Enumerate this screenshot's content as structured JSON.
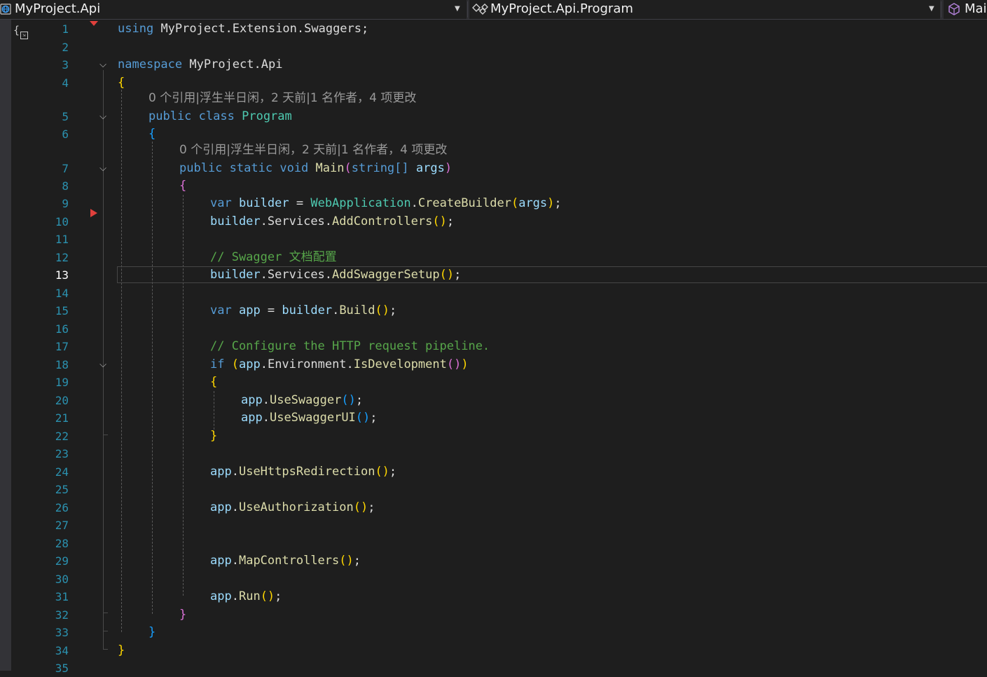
{
  "navbar": {
    "project": "MyProject.Api",
    "type_member": "MyProject.Api.Program",
    "member": "Mai"
  },
  "editor": {
    "active_line": 13,
    "line_numbers": [
      "1",
      "2",
      "3",
      "4",
      "5",
      "6",
      "7",
      "8",
      "9",
      "10",
      "11",
      "12",
      "13",
      "14",
      "15",
      "16",
      "17",
      "18",
      "19",
      "20",
      "21",
      "22",
      "23",
      "24",
      "25",
      "26",
      "27",
      "28",
      "29",
      "30",
      "31",
      "32",
      "33",
      "34",
      "35"
    ],
    "codelens": {
      "class_program": "0 个引用|浮生半日闲，2 天前|1 名作者，4 项更改",
      "method_main": "0 个引用|浮生半日闲，2 天前|1 名作者，4 项更改"
    },
    "tokens": {
      "using": "using",
      "using_ns": "MyProject.Extension.Swaggers;",
      "namespace": "namespace",
      "ns_name": "MyProject.Api",
      "public": "public",
      "class": "class",
      "class_name": "Program",
      "static": "static",
      "void": "void",
      "main": "Main",
      "string_arr": "string[]",
      "args": "args",
      "var": "var",
      "builder": "builder",
      "webapp": "WebApplication",
      "create_builder": "CreateBuilder",
      "services": "Services",
      "add_controllers": "AddControllers",
      "comment_swagger": "// Swagger 文档配置",
      "add_swagger_setup": "AddSwaggerSetup",
      "app": "app",
      "build": "Build",
      "comment_pipeline": "// Configure the HTTP request pipeline.",
      "if": "if",
      "environment": "Environment",
      "is_development": "IsDevelopment",
      "use_swagger": "UseSwagger",
      "use_swagger_ui": "UseSwaggerUI",
      "use_https": "UseHttpsRedirection",
      "use_auth": "UseAuthorization",
      "map_controllers": "MapControllers",
      "run": "Run"
    }
  },
  "colors": {
    "keyword": "#569cd6",
    "type": "#4ec9b0",
    "method": "#dcdcaa",
    "parameter": "#9cdcfe",
    "comment": "#57a64a",
    "line_number": "#2b91af",
    "bracket_1": "#ffd700",
    "bracket_2": "#da70d6",
    "bracket_3": "#179fff"
  },
  "icons": {
    "project_icon": "csharp-project-icon",
    "type_icon": "class-icon",
    "member_icon": "method-cube-icon",
    "dropdown_icon": "chevron-down-icon",
    "fold_icon": "collapse-chevron-icon",
    "breakpoint_icon": "breakpoint-arrow-icon"
  }
}
